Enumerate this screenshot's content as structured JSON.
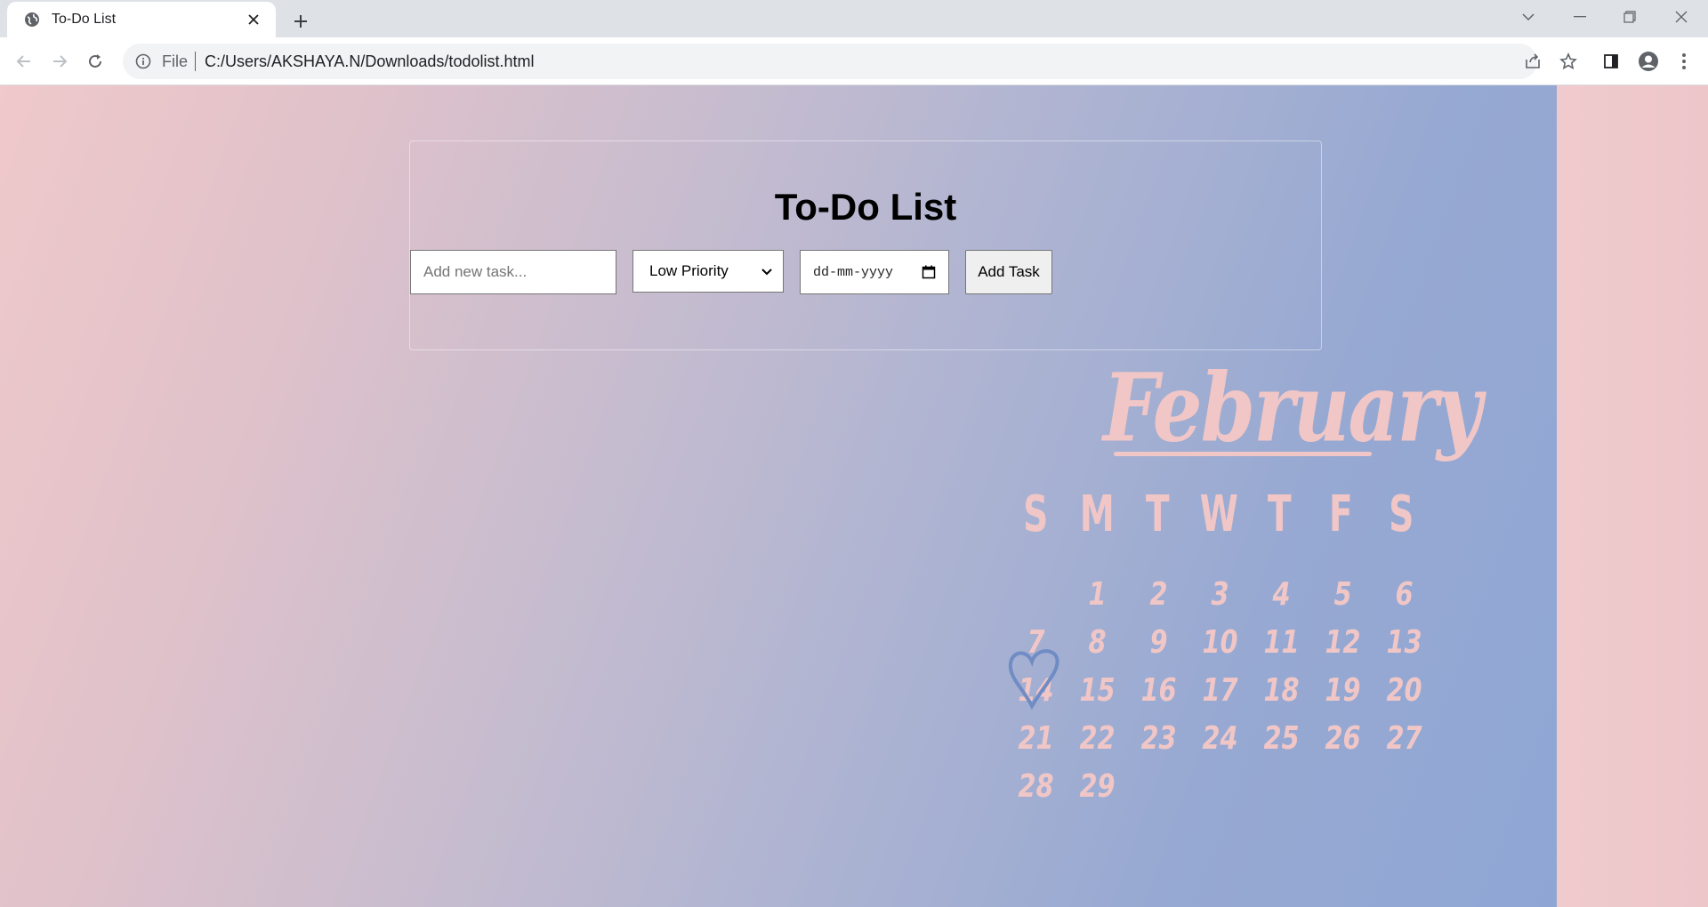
{
  "browser": {
    "tab": {
      "title": "To-Do List",
      "favicon": "globe-icon"
    },
    "address_bar": {
      "scheme_label": "File",
      "url": "C:/Users/AKSHAYA.N/Downloads/todolist.html"
    }
  },
  "page": {
    "title": "To-Do List",
    "task_input": {
      "placeholder": "Add new task...",
      "value": ""
    },
    "priority_select": {
      "selected": "Low Priority"
    },
    "date_input": {
      "placeholder": "dd-mm-yyyy"
    },
    "add_button_label": "Add Task"
  },
  "wallpaper": {
    "month": "February",
    "weekdays": [
      "S",
      "M",
      "T",
      "W",
      "T",
      "F",
      "S"
    ],
    "days": [
      "",
      "1",
      "2",
      "3",
      "4",
      "5",
      "6",
      "7",
      "8",
      "9",
      "10",
      "11",
      "12",
      "13",
      "14",
      "15",
      "16",
      "17",
      "18",
      "19",
      "20",
      "21",
      "22",
      "23",
      "24",
      "25",
      "26",
      "27",
      "28",
      "29"
    ],
    "highlighted_day": "14",
    "colors": {
      "lettering": "#f0c6c6",
      "heart": "#6f8cc4"
    }
  }
}
